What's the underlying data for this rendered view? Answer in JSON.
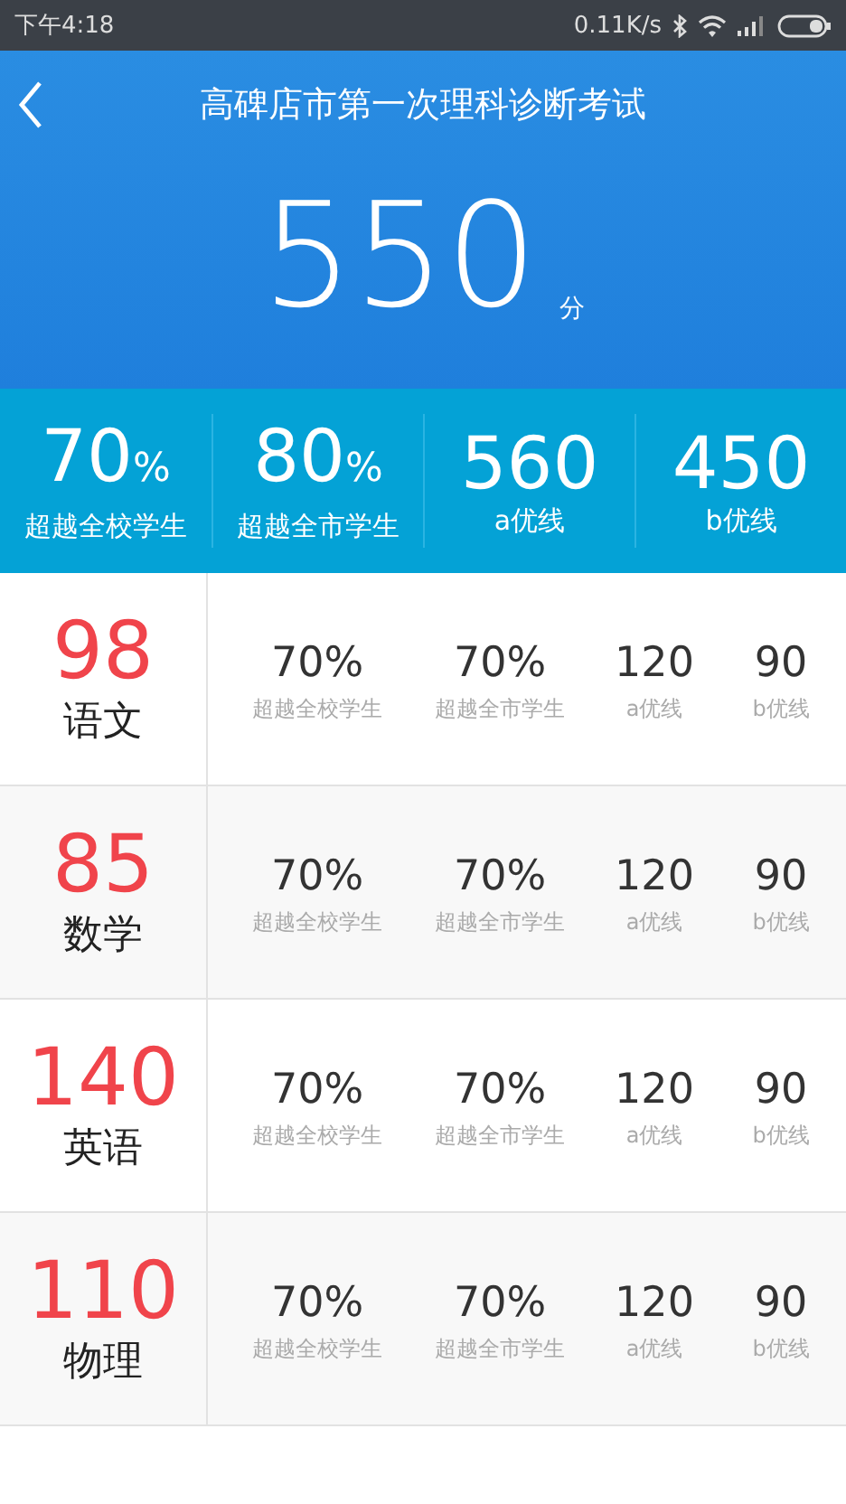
{
  "status_bar": {
    "time": "下午4:18",
    "speed": "0.11K/s"
  },
  "header": {
    "title": "高碑店市第一次理科诊断考试",
    "score": "550",
    "unit": "分"
  },
  "summary": [
    {
      "value": "70",
      "suffix": "%",
      "label": "超越全校学生"
    },
    {
      "value": "80",
      "suffix": "%",
      "label": "超越全市学生"
    },
    {
      "value": "560",
      "label": "a优线"
    },
    {
      "value": "450",
      "label": "b优线"
    }
  ],
  "subjects": [
    {
      "score": "98",
      "name": "语文",
      "stats": [
        {
          "value": "70%",
          "label": "超越全校学生"
        },
        {
          "value": "70%",
          "label": "超越全市学生"
        },
        {
          "value": "120",
          "label": "a优线"
        },
        {
          "value": "90",
          "label": "b优线"
        }
      ]
    },
    {
      "score": "85",
      "name": "数学",
      "stats": [
        {
          "value": "70%",
          "label": "超越全校学生"
        },
        {
          "value": "70%",
          "label": "超越全市学生"
        },
        {
          "value": "120",
          "label": "a优线"
        },
        {
          "value": "90",
          "label": "b优线"
        }
      ]
    },
    {
      "score": "140",
      "name": "英语",
      "stats": [
        {
          "value": "70%",
          "label": "超越全校学生"
        },
        {
          "value": "70%",
          "label": "超越全市学生"
        },
        {
          "value": "120",
          "label": "a优线"
        },
        {
          "value": "90",
          "label": "b优线"
        }
      ]
    },
    {
      "score": "110",
      "name": "物理",
      "stats": [
        {
          "value": "70%",
          "label": "超越全校学生"
        },
        {
          "value": "70%",
          "label": "超越全市学生"
        },
        {
          "value": "120",
          "label": "a优线"
        },
        {
          "value": "90",
          "label": "b优线"
        }
      ]
    }
  ]
}
